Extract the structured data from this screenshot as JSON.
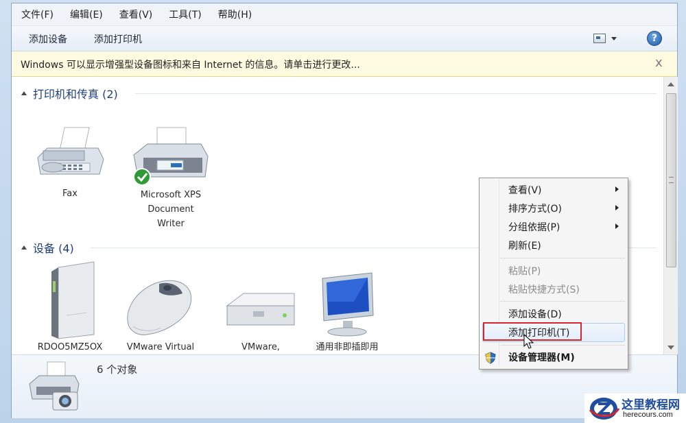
{
  "menubar": {
    "items": [
      "文件(F)",
      "编辑(E)",
      "查看(V)",
      "工具(T)",
      "帮助(H)"
    ]
  },
  "toolbar": {
    "add_device": "添加设备",
    "add_printer": "添加打印机",
    "help_glyph": "?"
  },
  "infobar": {
    "text": "Windows 可以显示增强型设备图标和来自 Internet 的信息。请单击进行更改...",
    "close_glyph": "x"
  },
  "groups": [
    {
      "title": "打印机和传真 (2)",
      "items": [
        {
          "label": "Fax",
          "icon": "fax-icon"
        },
        {
          "label": "Microsoft XPS\nDocument\nWriter",
          "icon": "printer-icon"
        }
      ]
    },
    {
      "title": "设备 (4)",
      "items": [
        {
          "label": "RDOO5MZ5OX",
          "icon": "computer-tower-icon"
        },
        {
          "label": "VMware Virtual",
          "icon": "mouse-icon"
        },
        {
          "label": "VMware,",
          "icon": "drive-icon"
        },
        {
          "label": "通用非即插即用",
          "icon": "monitor-icon"
        }
      ]
    }
  ],
  "details": {
    "count": "6 个对象"
  },
  "context_menu": {
    "items": [
      {
        "label": "查看(V)",
        "submenu": true,
        "enabled": true
      },
      {
        "label": "排序方式(O)",
        "submenu": true,
        "enabled": true
      },
      {
        "label": "分组依据(P)",
        "submenu": true,
        "enabled": true
      },
      {
        "label": "刷新(E)",
        "submenu": false,
        "enabled": true
      },
      {
        "label": "粘贴(P)",
        "submenu": false,
        "enabled": false
      },
      {
        "label": "粘贴快捷方式(S)",
        "submenu": false,
        "enabled": false
      },
      {
        "label": "添加设备(D)",
        "submenu": false,
        "enabled": true
      },
      {
        "label": "添加打印机(T)",
        "submenu": false,
        "enabled": true,
        "highlighted": true
      },
      {
        "label": "设备管理器(M)",
        "submenu": false,
        "enabled": true,
        "icon": "shield-icon"
      }
    ]
  },
  "watermark": {
    "title": "这里教程网",
    "url": "herecours.com"
  },
  "colors": {
    "highlight_border": "#d6262d",
    "group_title": "#1e3f7a",
    "infobar_bg": "#fffbe0"
  }
}
